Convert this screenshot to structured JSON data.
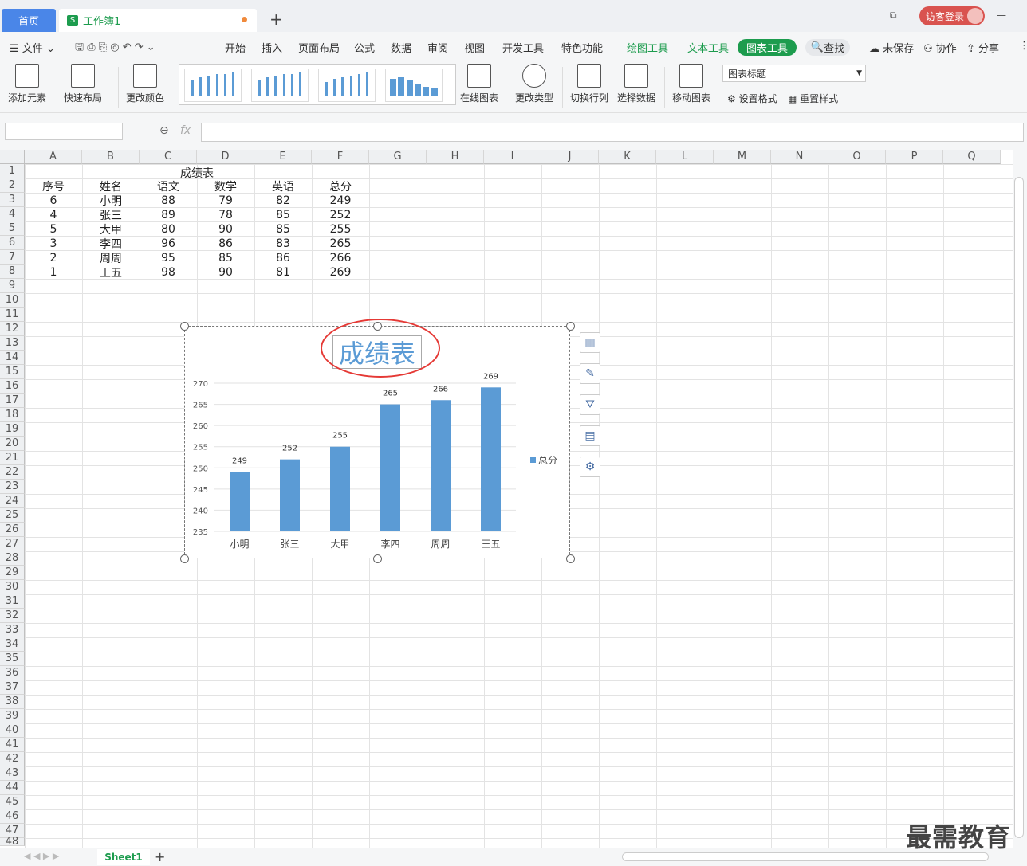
{
  "tabs": {
    "home": "首页",
    "doc": "工作簿1",
    "login": "访客登录"
  },
  "menu": {
    "file": "文件",
    "items": [
      "开始",
      "插入",
      "页面布局",
      "公式",
      "数据",
      "审阅",
      "视图",
      "开发工具",
      "特色功能"
    ],
    "draw_tool": "绘图工具",
    "text_tool": "文本工具",
    "chart_tool": "图表工具",
    "search": "查找",
    "unsaved": "未保存",
    "collab": "协作",
    "share": "分享"
  },
  "ribbon": {
    "add_element": "添加元素",
    "quick_layout": "快速布局",
    "change_color": "更改颜色",
    "online_chart": "在线图表",
    "change_type": "更改类型",
    "switch_rowcol": "切换行列",
    "select_data": "选择数据",
    "move_chart": "移动图表",
    "title_select": "图表标题",
    "set_format": "设置格式",
    "reset_style": "重置样式"
  },
  "formula": {
    "fx": "fx"
  },
  "columns": [
    "A",
    "B",
    "C",
    "D",
    "E",
    "F",
    "G",
    "H",
    "I",
    "J",
    "K",
    "L",
    "M",
    "N",
    "O",
    "P",
    "Q"
  ],
  "table": {
    "title": "成绩表",
    "headers": [
      "序号",
      "姓名",
      "语文",
      "数学",
      "英语",
      "总分"
    ],
    "rows": [
      [
        "6",
        "小明",
        "88",
        "79",
        "82",
        "249"
      ],
      [
        "4",
        "张三",
        "89",
        "78",
        "85",
        "252"
      ],
      [
        "5",
        "大甲",
        "80",
        "90",
        "85",
        "255"
      ],
      [
        "3",
        "李四",
        "96",
        "86",
        "83",
        "265"
      ],
      [
        "2",
        "周周",
        "95",
        "85",
        "86",
        "266"
      ],
      [
        "1",
        "王五",
        "98",
        "90",
        "81",
        "269"
      ]
    ]
  },
  "chart_data": {
    "type": "bar",
    "title": "成绩表",
    "categories": [
      "小明",
      "张三",
      "大甲",
      "李四",
      "周周",
      "王五"
    ],
    "series": [
      {
        "name": "总分",
        "values": [
          249,
          252,
          255,
          265,
          266,
          269
        ],
        "color": "#5b9bd5"
      }
    ],
    "ylim": [
      235,
      270
    ],
    "yticks": [
      235,
      240,
      245,
      250,
      255,
      260,
      265,
      270
    ],
    "legend": "right",
    "grid": true
  },
  "sheet_tab": "Sheet1",
  "watermark": "最需教育"
}
